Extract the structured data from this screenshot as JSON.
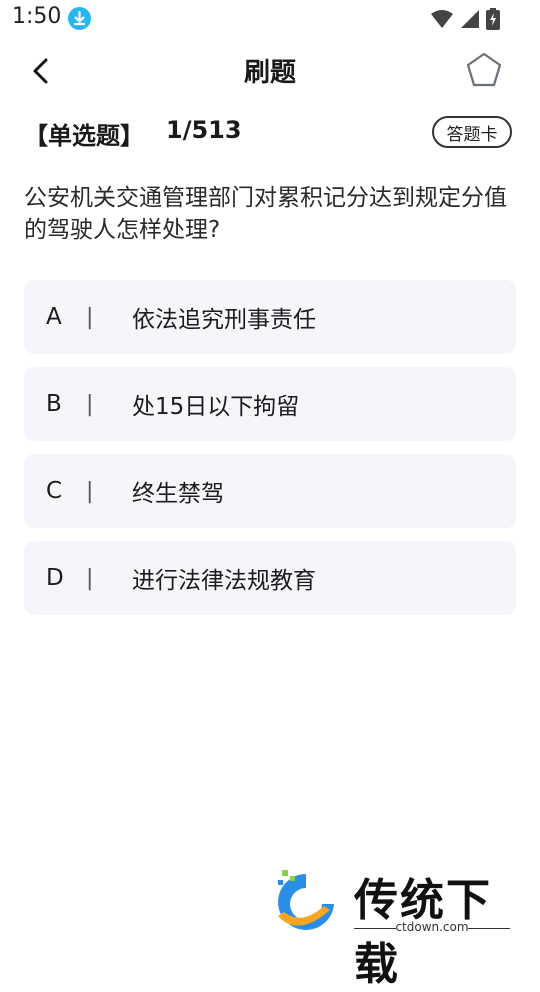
{
  "status_bar": {
    "time": "1:50"
  },
  "header": {
    "title": "刷题"
  },
  "question_info": {
    "type_label": "【单选题】",
    "progress": "1/513",
    "answer_card_label": "答题卡"
  },
  "question": {
    "text": "公安机关交通管理部门对累积记分达到规定分值的驾驶人怎样处理?"
  },
  "options": [
    {
      "letter": "A",
      "separator": "|",
      "text": "依法追究刑事责任"
    },
    {
      "letter": "B",
      "separator": "|",
      "text": "处15日以下拘留"
    },
    {
      "letter": "C",
      "separator": "|",
      "text": "终生禁驾"
    },
    {
      "letter": "D",
      "separator": "|",
      "text": "进行法律法规教育"
    }
  ],
  "watermark": {
    "name": "传统下载",
    "domain": "ctdown.com"
  },
  "icons": {
    "download": "download-icon",
    "wifi": "wifi-icon",
    "signal": "signal-icon",
    "battery": "battery-icon",
    "back": "back-arrow-icon",
    "favorite": "star-icon"
  },
  "colors": {
    "option_bg": "#f5f6fb",
    "download_badge": "#26b6f0"
  }
}
